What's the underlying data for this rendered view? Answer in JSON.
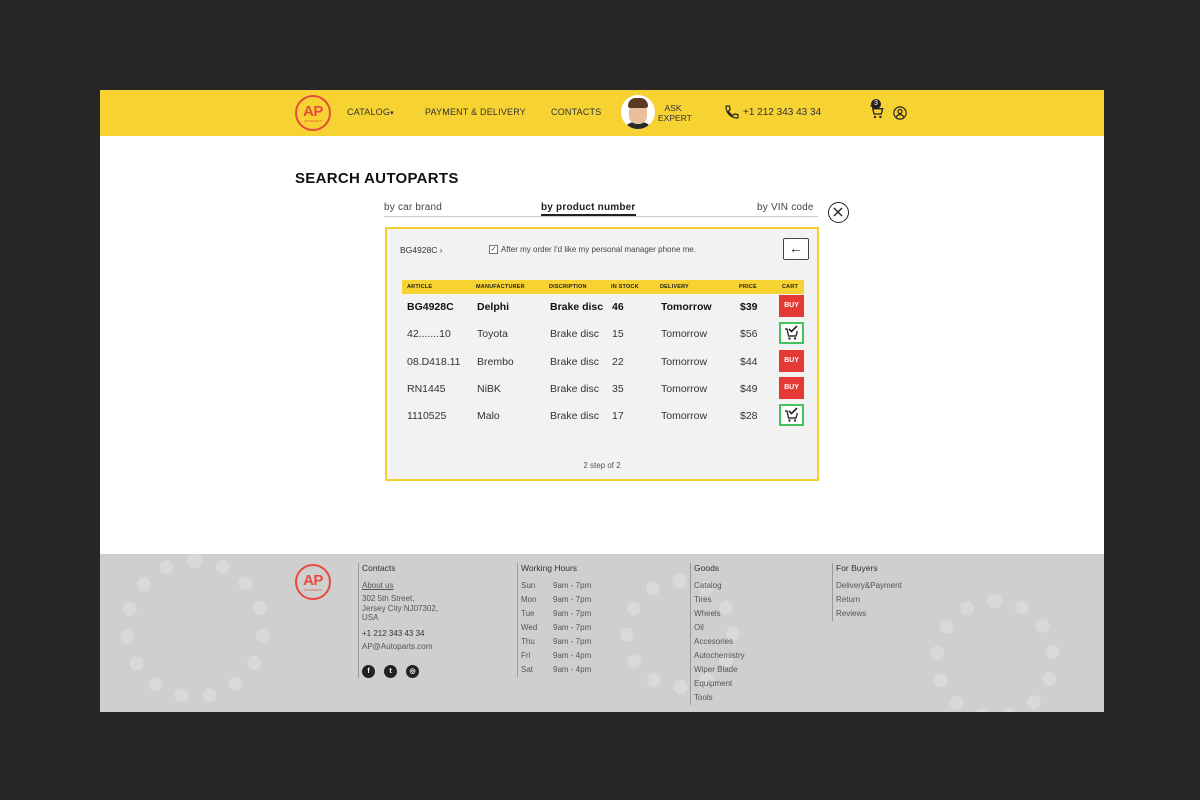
{
  "brand": {
    "logo_text": "AP",
    "logo_subtext": "AUTOPARTS",
    "color": "#e84a3c"
  },
  "header": {
    "nav": [
      {
        "label": "CATALOG",
        "has_dropdown": true
      },
      {
        "label": "PAYMENT & DELIVERY"
      },
      {
        "label": "CONTACTS"
      }
    ],
    "ask_line1": "ASK",
    "ask_line2": "EXPERT",
    "phone": "+1 212 343 43 34",
    "cart_count": "3",
    "background": "#f6d233"
  },
  "main": {
    "title": "SEARCH AUTOPARTS",
    "tabs": [
      {
        "label": "by car brand",
        "active": false
      },
      {
        "label": "by product number",
        "active": true
      },
      {
        "label": "by VIN code",
        "active": false
      }
    ],
    "search": {
      "crumb": "BG4928C",
      "checkbox_checked": true,
      "checkbox_label": "After my order I'd like my personal manager phone me.",
      "back_label": "←",
      "columns": [
        "ARTICLE",
        "MANUFACTURER",
        "DISCRIPTION",
        "IN STOCK",
        "DELIVERY",
        "PRICE",
        "CART"
      ],
      "rows": [
        {
          "article": "BG4928C",
          "manufacturer": "Delphi",
          "description": "Brake disc",
          "stock": "46",
          "delivery": "Tomorrow",
          "price": "$39",
          "cart": "BUY",
          "in_cart": false
        },
        {
          "article": "42.......10",
          "manufacturer": "Toyota",
          "description": "Brake disc",
          "stock": "15",
          "delivery": "Tomorrow",
          "price": "$56",
          "cart": "",
          "in_cart": true
        },
        {
          "article": "08.D418.11",
          "manufacturer": "Brembo",
          "description": "Brake disc",
          "stock": "22",
          "delivery": "Tomorrow",
          "price": "$44",
          "cart": "BUY",
          "in_cart": false
        },
        {
          "article": "RN1445",
          "manufacturer": "NiBK",
          "description": "Brake disc",
          "stock": "35",
          "delivery": "Tomorrow",
          "price": "$49",
          "cart": "BUY",
          "in_cart": false
        },
        {
          "article": "1110525",
          "manufacturer": "Malo",
          "description": "Brake disc",
          "stock": "17",
          "delivery": "Tomorrow",
          "price": "$28",
          "cart": "",
          "in_cart": true
        }
      ],
      "step": "2 step of 2"
    },
    "colors": {
      "accent": "#f6d233",
      "buy": "#e53935",
      "in_cart": "#43c25f"
    }
  },
  "footer": {
    "contacts": {
      "heading": "Contacts",
      "about": "About us",
      "address": [
        "302 5th Street,",
        "Jersey City NJ07302,",
        "USA"
      ],
      "phone": "+1 212 343 43 34",
      "email": "AP@Autoparts.com",
      "socials": [
        "facebook-icon",
        "twitter-icon",
        "instagram-icon"
      ]
    },
    "hours": {
      "heading": "Working Hours",
      "rows": [
        {
          "day": "Sun",
          "time": "9am - 7pm"
        },
        {
          "day": "Mon",
          "time": "9am - 7pm"
        },
        {
          "day": "Tue",
          "time": "9am - 7pm"
        },
        {
          "day": "Wed",
          "time": "9am - 7pm"
        },
        {
          "day": "Thu",
          "time": "9am - 7pm"
        },
        {
          "day": "Fri",
          "time": "9am - 4pm"
        },
        {
          "day": "Sat",
          "time": "9am - 4pm"
        }
      ]
    },
    "goods": {
      "heading": "Goods",
      "items": [
        "Catalog",
        "Tires",
        "Wheels",
        "Oil",
        "Accesories",
        "Autochemistry",
        "Wiper Blade",
        "Equipment",
        "Tools"
      ]
    },
    "buyers": {
      "heading": "For Buyers",
      "items": [
        "Delivery&Payment",
        "Return",
        "Reviews"
      ]
    }
  }
}
